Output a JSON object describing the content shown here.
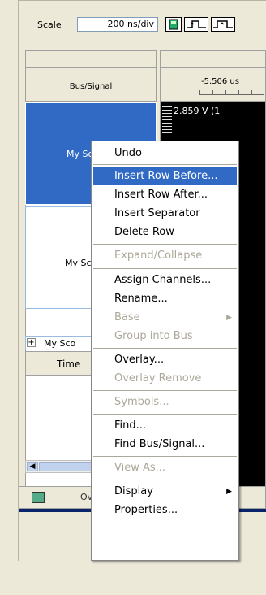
{
  "toolbar": {
    "scale_label": "Scale",
    "scale_value": "200 ns/div",
    "buttons": [
      "calculator-icon",
      "trigger-rise-icon",
      "trigger-pulse-icon"
    ]
  },
  "grid": {
    "left_header": "Bus/Signal",
    "right_header_time": "-5.506 us",
    "rows": [
      {
        "label": "My Sco",
        "selected": true
      },
      {
        "label": "My Sco",
        "selected": false
      },
      {
        "label": "My Sco",
        "collapsed": true
      },
      {
        "label": "Time"
      }
    ],
    "voltage_readout": "2.859 V (1"
  },
  "bottom": {
    "label": "Ov"
  },
  "context_menu": {
    "items": [
      {
        "label": "Undo",
        "disabled": false
      },
      {
        "label": "Insert Row Before...",
        "highlighted": true
      },
      {
        "label": "Insert Row After...",
        "disabled": false
      },
      {
        "label": "Insert Separator",
        "disabled": false
      },
      {
        "label": "Delete Row",
        "disabled": false
      },
      {
        "label": "Expand/Collapse",
        "disabled": true
      },
      {
        "label": "Assign Channels...",
        "disabled": false
      },
      {
        "label": "Rename...",
        "disabled": false
      },
      {
        "label": "Base",
        "disabled": true,
        "submenu": true
      },
      {
        "label": "Group into Bus",
        "disabled": true
      },
      {
        "label": "Overlay...",
        "disabled": false
      },
      {
        "label": "Overlay Remove",
        "disabled": true
      },
      {
        "label": "Symbols...",
        "disabled": true
      },
      {
        "label": "Find...",
        "disabled": false
      },
      {
        "label": "Find Bus/Signal...",
        "disabled": false
      },
      {
        "label": "View As...",
        "disabled": true
      },
      {
        "label": "Display",
        "disabled": false,
        "submenu": true
      },
      {
        "label": "Properties...",
        "disabled": false
      }
    ]
  }
}
